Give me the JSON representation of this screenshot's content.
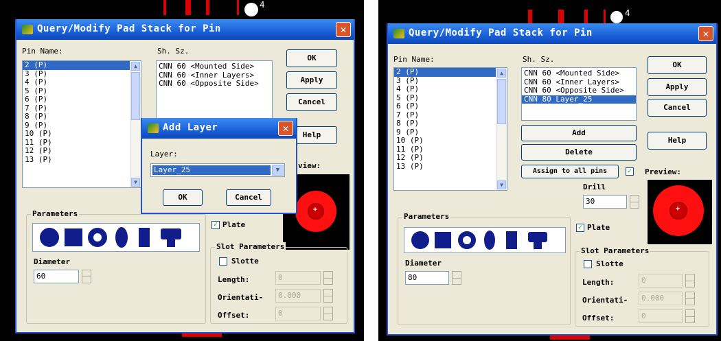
{
  "left_panel": {
    "pcb_number": "4",
    "main_dialog": {
      "title": "Query/Modify Pad Stack for Pin",
      "close_glyph": "✕",
      "pin_name_label": "Pin Name:",
      "pins": [
        "2  (P)",
        "3  (P)",
        "4  (P)",
        "5  (P)",
        "6  (P)",
        "7  (P)",
        "8  (P)",
        "9  (P)",
        "10  (P)",
        "11  (P)",
        "12  (P)",
        "13  (P)"
      ],
      "selected_pin_index": 0,
      "shape_size_label": "Sh. Sz.",
      "stack_items": [
        "CNN 60 <Mounted Side>",
        "CNN 60 <Inner Layers>",
        "CNN 60 <Opposite Side>"
      ],
      "ok_label": "OK",
      "apply_label": "Apply",
      "cancel_label": "Cancel",
      "help_label": "Help",
      "preview_label": "view:",
      "parameters_label": "Parameters",
      "diameter_label": "Diameter",
      "diameter_value": "60",
      "plate_label": "Plate",
      "plate_checked": "✓",
      "slot_params_label": "Slot Parameters",
      "slotted_label": "Slotte",
      "length_label": "Length:",
      "length_value": "0",
      "orientation_label": "Orientati-",
      "orientation_value": "0.000",
      "offset_label": "Offset:",
      "offset_value": "0"
    },
    "add_layer_dialog": {
      "title": "Add Layer",
      "close_glyph": "✕",
      "layer_label": "Layer:",
      "layer_value": "Layer_25",
      "ok_label": "OK",
      "cancel_label": "Cancel"
    }
  },
  "right_panel": {
    "pcb_number": "4",
    "main_dialog": {
      "title": "Query/Modify Pad Stack for Pin",
      "close_glyph": "✕",
      "pin_name_label": "Pin Name:",
      "pins": [
        "2  (P)",
        "3  (P)",
        "4  (P)",
        "5  (P)",
        "6  (P)",
        "7  (P)",
        "8  (P)",
        "9  (P)",
        "10  (P)",
        "11  (P)",
        "12  (P)",
        "13  (P)"
      ],
      "selected_pin_index": 0,
      "shape_size_label": "Sh. Sz.",
      "stack_items": [
        "CNN 60 <Mounted Side>",
        "CNN 60 <Inner Layers>",
        "CNN 60 <Opposite Side>",
        "CNN 80 Layer_25"
      ],
      "selected_stack_index": 3,
      "ok_label": "OK",
      "apply_label": "Apply",
      "cancel_label": "Cancel",
      "help_label": "Help",
      "add_label": "Add",
      "delete_label": "Delete",
      "assign_all_label": "Assign to all pins",
      "assign_all_checked": "✓",
      "preview_label": "Preview:",
      "drill_label": "Drill",
      "drill_value": "30",
      "parameters_label": "Parameters",
      "diameter_label": "Diameter",
      "diameter_value": "80",
      "plate_label": "Plate",
      "plate_checked": "✓",
      "slot_params_label": "Slot Parameters",
      "slotted_label": "Slotte",
      "length_label": "Length:",
      "length_value": "0",
      "orientation_label": "Orientati-",
      "orientation_value": "0.000",
      "offset_label": "Offset:",
      "offset_value": "0"
    }
  }
}
